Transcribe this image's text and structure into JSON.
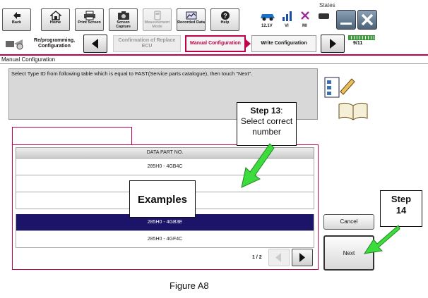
{
  "status": {
    "label": "States"
  },
  "toolbar": {
    "buttons": [
      {
        "label": "Back"
      },
      {
        "label": "Home"
      },
      {
        "label": "Print Screen"
      },
      {
        "label": "Screen Capture"
      },
      {
        "label": "Measurement Mode"
      },
      {
        "label": "Recorded Data"
      },
      {
        "label": "Help"
      }
    ],
    "voltage": "12.1V",
    "vi": "VI",
    "mi": "MI"
  },
  "breadcrumb": {
    "step1": "Re/programming, Configuration",
    "step2": "Confirmation of Replace ECU",
    "step3": "Manual Configuration",
    "step4": "Write Configuration",
    "page": "9/11"
  },
  "section_title": "Manual Configuration",
  "instruction": "Select Type ID from following table which is equal to FAST(Service parts catalogue), then touch \"Next\".",
  "table": {
    "header": "DATA PART NO.",
    "rows": [
      "285H0 - 4GB4C",
      "",
      "",
      "285H0 - 4GB3E",
      "285H0 - 4GF4C"
    ],
    "selected_index": 3,
    "pager": "1 / 2"
  },
  "buttons": {
    "cancel": "Cancel",
    "next": "Next"
  },
  "callouts": {
    "step13_title": "Step 13",
    "step13_colon": ":",
    "step13_line1": "Select correct",
    "step13_line2": "number",
    "examples": "Examples",
    "step14_line1": "Step",
    "step14_line2": "14"
  },
  "figure_caption": "Figure A8",
  "colors": {
    "accent": "#c0004a",
    "selected_row": "#1c1469",
    "callout_arrow": "#33cc33"
  }
}
